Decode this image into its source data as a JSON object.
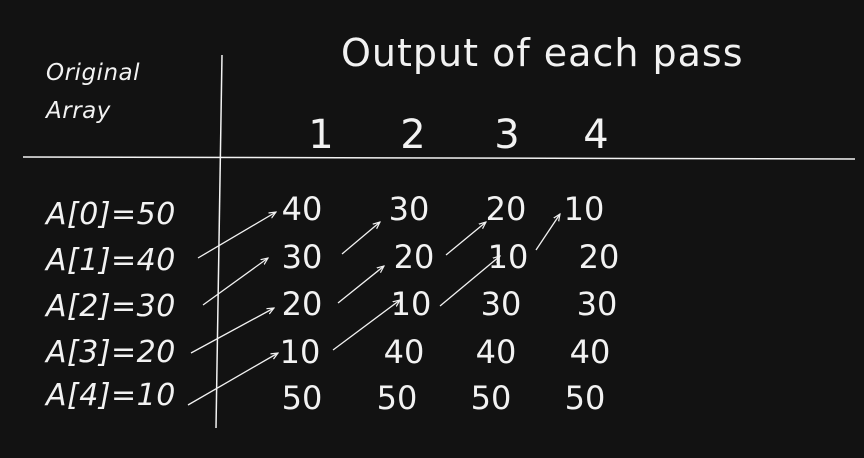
{
  "header": {
    "original_line1": "Original",
    "original_line2": "Array",
    "title": "Output of each pass",
    "passes": [
      "1",
      "2",
      "3",
      "4"
    ]
  },
  "original_array": [
    "A[0]=50",
    "A[1]=40",
    "A[2]=30",
    "A[3]=20",
    "A[4]=10"
  ],
  "pass_outputs": [
    [
      "40",
      "30",
      "20",
      "10",
      "50"
    ],
    [
      "30",
      "20",
      "10",
      "40",
      "50"
    ],
    [
      "20",
      "10",
      "30",
      "40",
      "50"
    ],
    [
      "10",
      "20",
      "30",
      "40",
      "50"
    ]
  ],
  "colors": {
    "background": "#121212",
    "ink": "#f2f2f2"
  }
}
